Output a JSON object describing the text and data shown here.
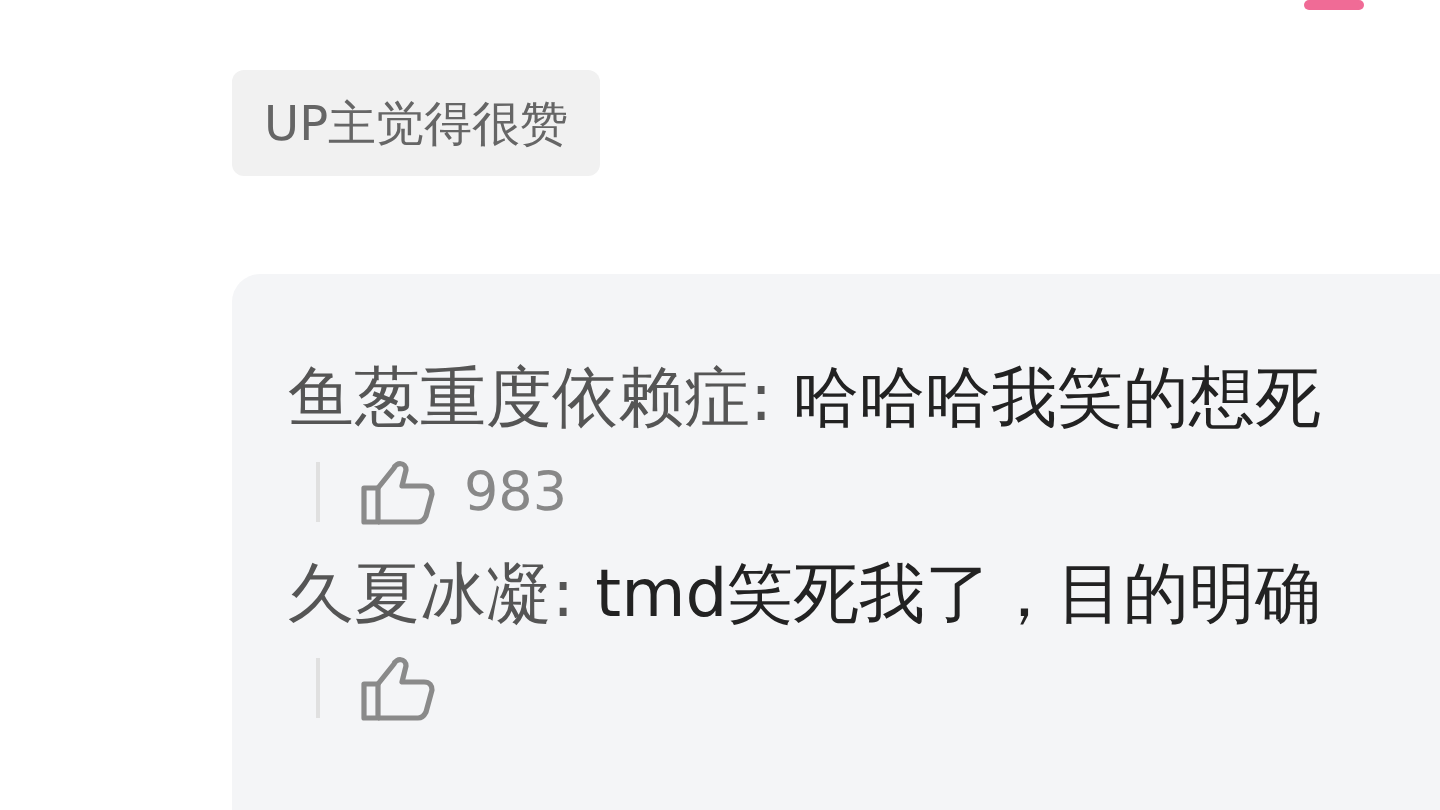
{
  "tag": "UP主觉得很赞",
  "replies": [
    {
      "author": "鱼葱重度依赖症:",
      "text": "哈哈哈我笑的想死",
      "likes": "983"
    },
    {
      "author": "久夏冰凝:",
      "text": "tmd笑死我了，目的明确"
    }
  ]
}
